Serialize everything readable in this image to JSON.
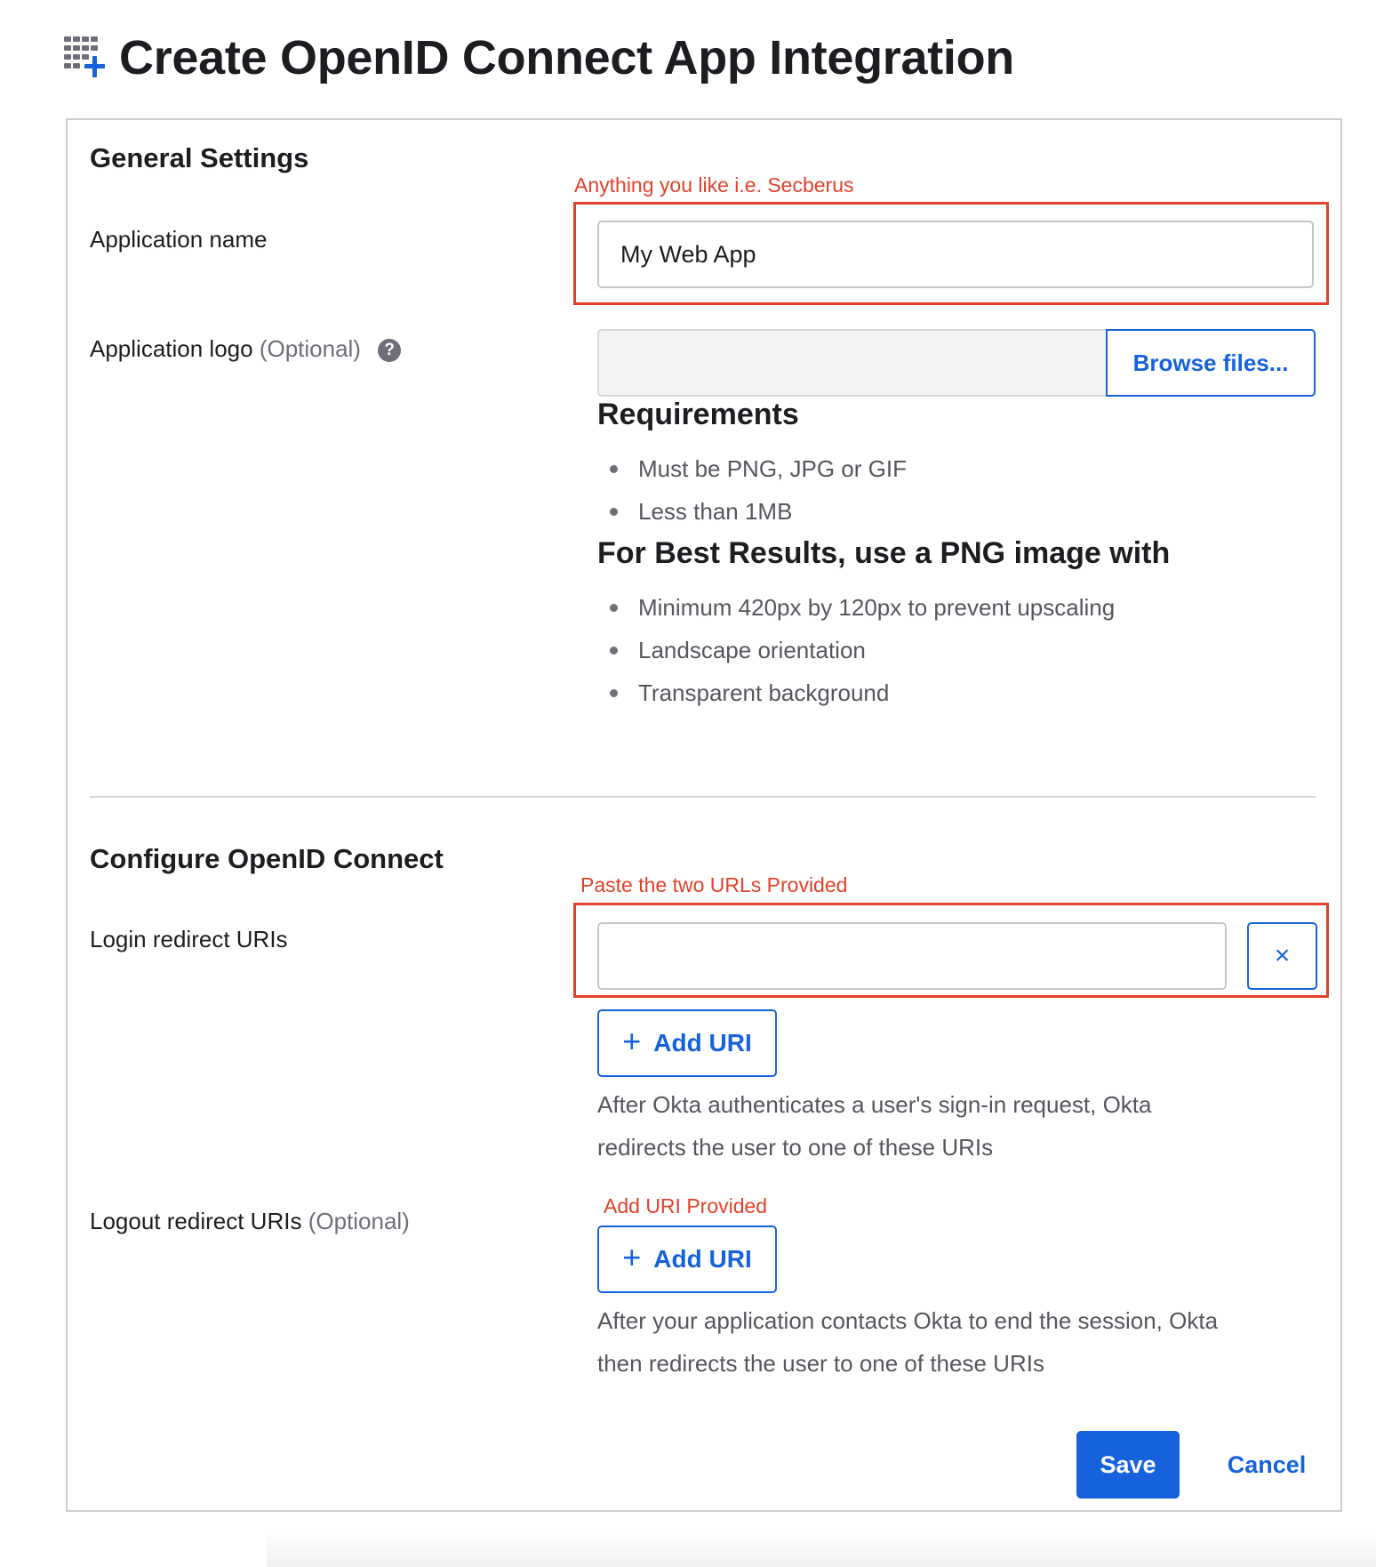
{
  "page": {
    "title": "Create OpenID Connect App Integration",
    "icon": "app-grid-plus-icon"
  },
  "general_settings": {
    "section_title": "General Settings",
    "app_name": {
      "label": "Application name",
      "value": "My Web App",
      "annotation": "Anything you like i.e. Secberus"
    },
    "app_logo": {
      "label": "Application logo",
      "optional_tag": "(Optional)",
      "help_icon": "?",
      "browse_label": "Browse files...",
      "requirements_heading": "Requirements",
      "requirements": [
        "Must be PNG, JPG or GIF",
        "Less than 1MB"
      ],
      "best_results_heading": "For Best Results, use a PNG image with",
      "best_results": [
        "Minimum 420px by 120px to prevent upscaling",
        "Landscape orientation",
        "Transparent background"
      ]
    }
  },
  "oidc": {
    "section_title": "Configure OpenID Connect",
    "login_redirect": {
      "label": "Login redirect URIs",
      "annotation": "Paste the two URLs Provided",
      "value": "",
      "clear_icon": "×",
      "add_label": "Add URI",
      "add_icon": "+",
      "help_line_1": "After Okta authenticates a user's sign-in request, Okta",
      "help_line_2": "redirects the user to one of these URIs"
    },
    "logout_redirect": {
      "label": "Logout redirect URIs",
      "optional_tag": "(Optional)",
      "annotation": "Add URI Provided",
      "add_label": "Add URI",
      "add_icon": "+",
      "help_line_1": "After your application contacts Okta to end the session, Okta",
      "help_line_2": "then redirects the user to one of these URIs"
    }
  },
  "actions": {
    "save_label": "Save",
    "cancel_label": "Cancel"
  },
  "colors": {
    "brand_blue": "#1662dd",
    "annotation_red": "#e4412b",
    "text_dark": "#1d1d21",
    "text_muted": "#56565e"
  }
}
